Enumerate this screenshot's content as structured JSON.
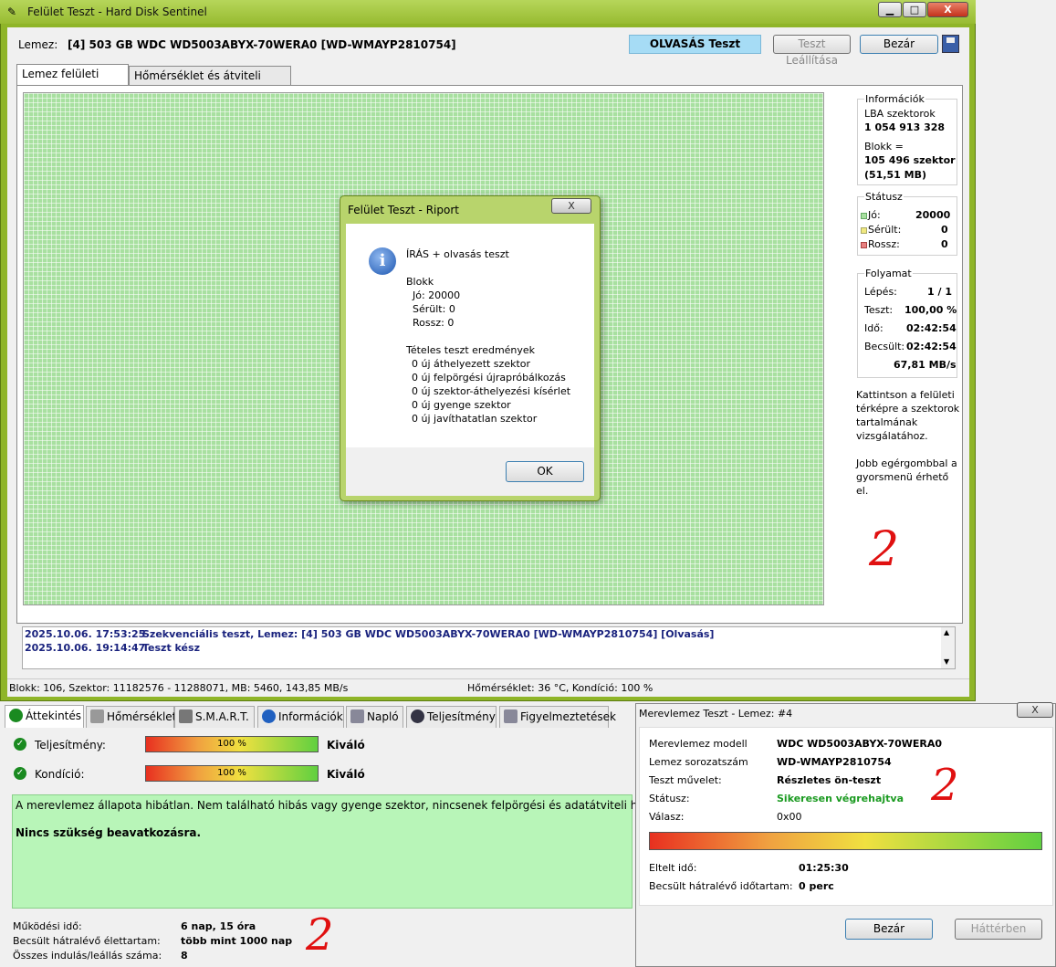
{
  "window": {
    "title": "Felület Teszt - Hard Disk Sentinel",
    "min": "▁",
    "max": "□",
    "close": "X"
  },
  "header": {
    "disk_label": "Lemez:",
    "disk_value": "[4] 503 GB  WDC WD5003ABYX-70WERA0 [WD-WMAYP2810754]",
    "mode": "OLVASÁS Teszt",
    "stop": "Teszt Leállítása",
    "close": "Bezár"
  },
  "tabs": [
    "Lemez felületi térkép",
    "Hőmérséklet és átviteli sebesség"
  ],
  "info": {
    "title": "Információk",
    "lba_label": "LBA szektorok",
    "lba_value": "1 054 913 328",
    "block_label": "Blokk =",
    "block_value": "105 496 szektor",
    "block_mb": "(51,51 MB)"
  },
  "status": {
    "title": "Státusz",
    "good_label": "Jó:",
    "good": "20000",
    "damaged_label": "Sérült:",
    "damaged": "0",
    "bad_label": "Rossz:",
    "bad": "0"
  },
  "progress": {
    "title": "Folyamat",
    "step_label": "Lépés:",
    "step": "1 / 1",
    "test_label": "Teszt:",
    "test": "100,00 %",
    "time_label": "Idő:",
    "time": "02:42:54",
    "est_label": "Becsült:",
    "est": "02:42:54",
    "speed": "67,81 MB/s"
  },
  "hint1": "Kattintson a felületi térképre a szektorok tartalmának vizsgálatához.",
  "hint2": "Jobb egérgombbal a gyorsmenü érhető el.",
  "annotation": "2",
  "log": [
    {
      "date": "2025.10.06.  17:53:25",
      "text": "Szekvenciális teszt, Lemez: [4] 503 GB  WDC WD5003ABYX-70WERA0 [WD-WMAYP2810754] [Olvasás]"
    },
    {
      "date": "2025.10.06.  19:14:47",
      "text": "Teszt kész"
    }
  ],
  "statusbar": {
    "left": "Blokk: 106, Szektor: 11182576 - 11288071, MB: 5460, 143,85 MB/s",
    "right": "Hőmérséklet: 36  °C,  Kondíció: 100 %"
  },
  "dialog": {
    "title": "Felület Teszt - Riport",
    "close": "X",
    "head": "ÍRÁS + olvasás teszt",
    "blokk": "Blokk",
    "good": "Jó: 20000",
    "damaged": "Sérült: 0",
    "bad": "Rossz: 0",
    "results_title": "Tételes teszt eredmények",
    "results": [
      "0 új áthelyezett szektor",
      "0 új felpörgési újrapróbálkozás",
      "0 új szektor-áthelyezési kísérlet",
      "0 új gyenge szektor",
      "0 új javíthatatlan szektor"
    ],
    "ok": "OK"
  },
  "bottom_tabs": [
    "Áttekintés",
    "Hőmérséklet",
    "S.M.A.R.T.",
    "Információk",
    "Napló",
    "Teljesítmény",
    "Figyelmeztetések"
  ],
  "overview": {
    "perf_label": "Teljesítmény:",
    "perf_pct": "100 %",
    "perf_value": 100,
    "perf_text": "Kiváló",
    "cond_label": "Kondíció:",
    "cond_pct": "100 %",
    "cond_value": 100,
    "cond_text": "Kiváló",
    "message": "A merevlemez állapota hibátlan. Nem található hibás vagy gyenge szektor, nincsenek felpörgési és adatátviteli hibák sem.",
    "message_bold": "Nincs szükség beavatkozásra.",
    "uptime_label": "Működési idő:",
    "uptime": "6 nap, 15 óra",
    "remaining_label": "Becsült hátralévő élettartam:",
    "remaining": "több mint 1000 nap",
    "starts_label": "Összes indulás/leállás száma:",
    "starts": "8"
  },
  "hdt": {
    "title": "Merevlemez Teszt - Lemez: #4",
    "close": "X",
    "model_label": "Merevlemez modell",
    "model": "WDC WD5003ABYX-70WERA0",
    "serial_label": "Lemez sorozatszám",
    "serial": "WD-WMAYP2810754",
    "op_label": "Teszt művelet:",
    "op": "Részletes ön-teszt",
    "status_label": "Státusz:",
    "status": "Sikeresen végrehajtva",
    "resp_label": "Válasz:",
    "resp": "0x00",
    "progress_value": 100,
    "elapsed_label": "Eltelt idő:",
    "elapsed": "01:25:30",
    "remain_label": "Becsült hátralévő időtartam:",
    "remain": "0 perc",
    "close_btn": "Bezár",
    "bg_btn": "Háttérben"
  }
}
